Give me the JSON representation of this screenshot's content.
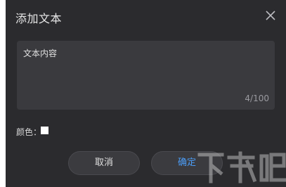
{
  "dialog": {
    "title": "添加文本",
    "close_icon": "close-icon"
  },
  "text_input": {
    "value": "文本内容",
    "counter": "4/100"
  },
  "color": {
    "label": "颜色：",
    "value": "#ffffff"
  },
  "buttons": {
    "cancel_label": "取消",
    "confirm_label": "确定"
  },
  "watermark": {
    "text": "下载吧"
  },
  "colors": {
    "dialog_bg": "#2b2b2e",
    "input_bg": "#3a3a3e",
    "accent": "#4b9cf5"
  }
}
